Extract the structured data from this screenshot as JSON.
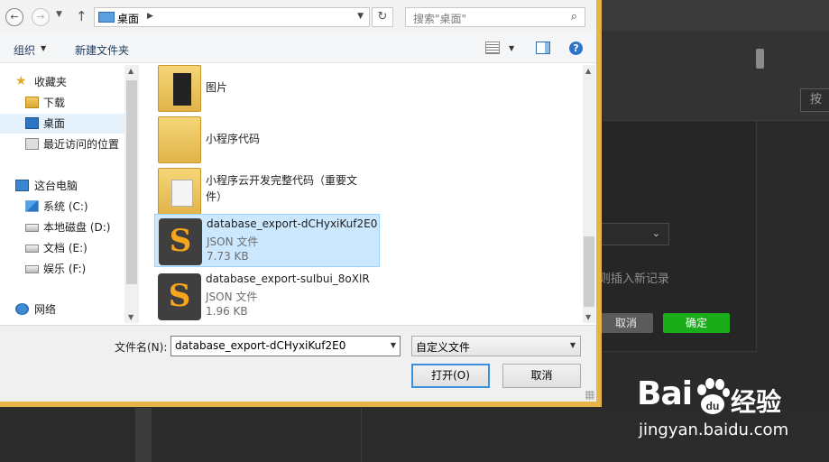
{
  "background_app": {
    "search_hint": "按",
    "insert_text": "则插入新记录",
    "cancel_label": "取消",
    "ok_label": "确定",
    "ok_color": "#1aad19"
  },
  "watermark": {
    "brand": "Bai",
    "brand2": "经验",
    "url": "jingyan.baidu.com"
  },
  "dialog": {
    "address": {
      "location": "桌面",
      "monitor_icon": "desktop-monitor-icon"
    },
    "search": {
      "placeholder": "搜索\"桌面\""
    },
    "toolbar": {
      "organize_label": "组织",
      "new_folder_label": "新建文件夹"
    },
    "nav": {
      "items": [
        {
          "label": "收藏夹",
          "icon": "star-icon"
        },
        {
          "label": "下载",
          "icon": "downloads-icon"
        },
        {
          "label": "桌面",
          "icon": "desktop-icon"
        },
        {
          "label": "最近访问的位置",
          "icon": "recent-places-icon"
        },
        {
          "label": "这台电脑",
          "icon": "computer-icon"
        },
        {
          "label": "系统 (C:)",
          "icon": "windows-drive-icon"
        },
        {
          "label": "本地磁盘 (D:)",
          "icon": "drive-icon"
        },
        {
          "label": "文档 (E:)",
          "icon": "drive-icon"
        },
        {
          "label": "娱乐 (F:)",
          "icon": "drive-icon"
        },
        {
          "label": "网络",
          "icon": "network-icon"
        }
      ]
    },
    "files": [
      {
        "name": "图片",
        "type": "folder"
      },
      {
        "name": "小程序代码",
        "type": "folder"
      },
      {
        "name_line1": "小程序云开发完整代码（重要文",
        "name_line2": "件）",
        "type": "folder"
      },
      {
        "name": "database_export-dCHyxiKuf2E0",
        "type_label": "JSON 文件",
        "size": "7.73 KB"
      },
      {
        "name": "database_export-suIbui_8oXlR",
        "type_label": "JSON 文件",
        "size": "1.96 KB"
      }
    ],
    "bottom": {
      "filename_label": "文件名(N):",
      "filename_value": "database_export-dCHyxiKuf2E0",
      "filetype_value": "自定义文件",
      "open_label": "打开(O)",
      "cancel_label": "取消"
    }
  }
}
